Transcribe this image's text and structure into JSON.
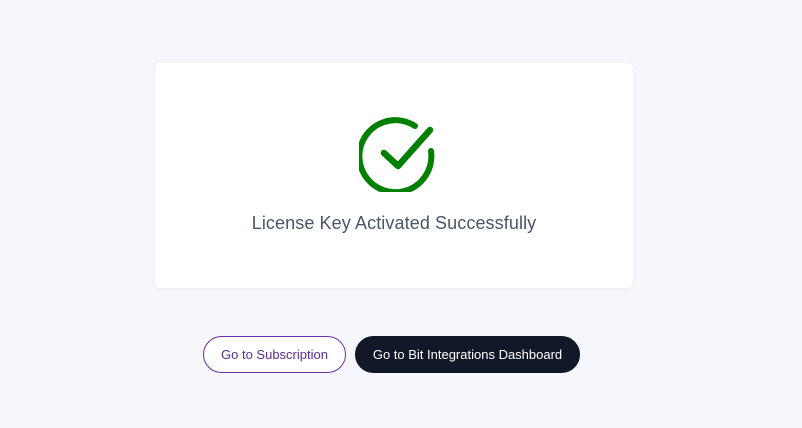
{
  "card": {
    "icon": "check-circle-icon",
    "message": "License Key Activated Successfully"
  },
  "actions": {
    "subscription_label": "Go to Subscription",
    "dashboard_label": "Go to Bit Integrations Dashboard"
  },
  "colors": {
    "page_background": "#f5f7fd",
    "success": "#008000",
    "outline_accent": "#6b2fa6",
    "dark_button": "#111827"
  }
}
